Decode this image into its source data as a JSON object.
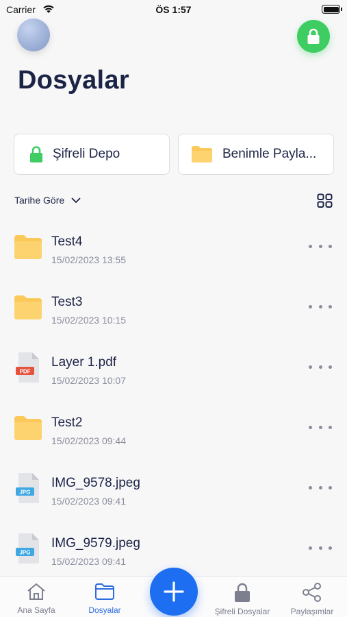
{
  "status_bar": {
    "carrier": "Carrier",
    "time": "ÖS 1:57"
  },
  "header": {
    "title": "Dosyalar"
  },
  "cards": {
    "secure": {
      "label": "Şifreli Depo",
      "icon": "green-lock-icon"
    },
    "shared": {
      "label": "Benimle Payla...",
      "icon": "folder-icon"
    }
  },
  "sort": {
    "label": "Tarihe Göre"
  },
  "files": [
    {
      "name": "Test4",
      "date": "15/02/2023 13:55",
      "type": "folder"
    },
    {
      "name": "Test3",
      "date": "15/02/2023 10:15",
      "type": "folder"
    },
    {
      "name": "Layer 1.pdf",
      "date": "15/02/2023 10:07",
      "type": "pdf",
      "badge": "PDF"
    },
    {
      "name": "Test2",
      "date": "15/02/2023 09:44",
      "type": "folder"
    },
    {
      "name": "IMG_9578.jpeg",
      "date": "15/02/2023 09:41",
      "type": "jpg",
      "badge": "JPG"
    },
    {
      "name": "IMG_9579.jpeg",
      "date": "15/02/2023 09:41",
      "type": "jpg",
      "badge": "JPG"
    }
  ],
  "tabs": {
    "home": "Ana Sayfa",
    "files": "Dosyalar",
    "secure": "Şifreli Dosyalar",
    "shares": "Paylaşımlar"
  },
  "colors": {
    "accent": "#1d6ef0",
    "lock_green": "#3ecd62",
    "folder": "#fbc95a",
    "pdf_badge": "#e5533f",
    "jpg_badge": "#3fa8e3"
  }
}
